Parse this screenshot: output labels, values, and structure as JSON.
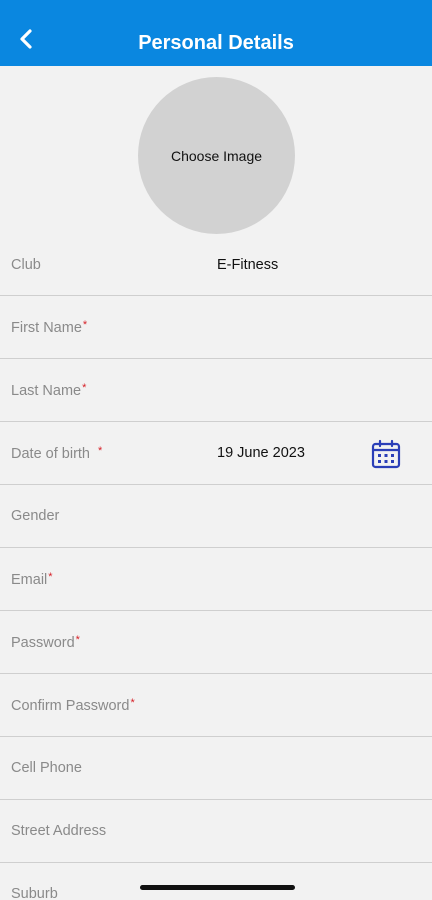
{
  "header": {
    "title": "Personal Details",
    "back_icon": "chevron-left-icon",
    "color": "#0a87e0"
  },
  "avatar": {
    "label": "Choose Image"
  },
  "form": {
    "club": {
      "label": "Club",
      "value": "E-Fitness"
    },
    "first_name": {
      "label": "First Name",
      "required": "*"
    },
    "last_name": {
      "label": "Last Name",
      "required": "*"
    },
    "dob": {
      "label": "Date of birth ",
      "required": "*",
      "value": "19 June 2023",
      "icon": "calendar-icon"
    },
    "gender": {
      "label": "Gender"
    },
    "email": {
      "label": "Email",
      "required": "*"
    },
    "password": {
      "label": "Password",
      "required": "*"
    },
    "confirm_password": {
      "label": "Confirm Password",
      "required": "*"
    },
    "cell_phone": {
      "label": "Cell Phone"
    },
    "street_address": {
      "label": "Street Address"
    },
    "suburb": {
      "label": "Suburb"
    }
  },
  "colors": {
    "required": "#d61f26",
    "calendar": "#2b3fb8"
  }
}
